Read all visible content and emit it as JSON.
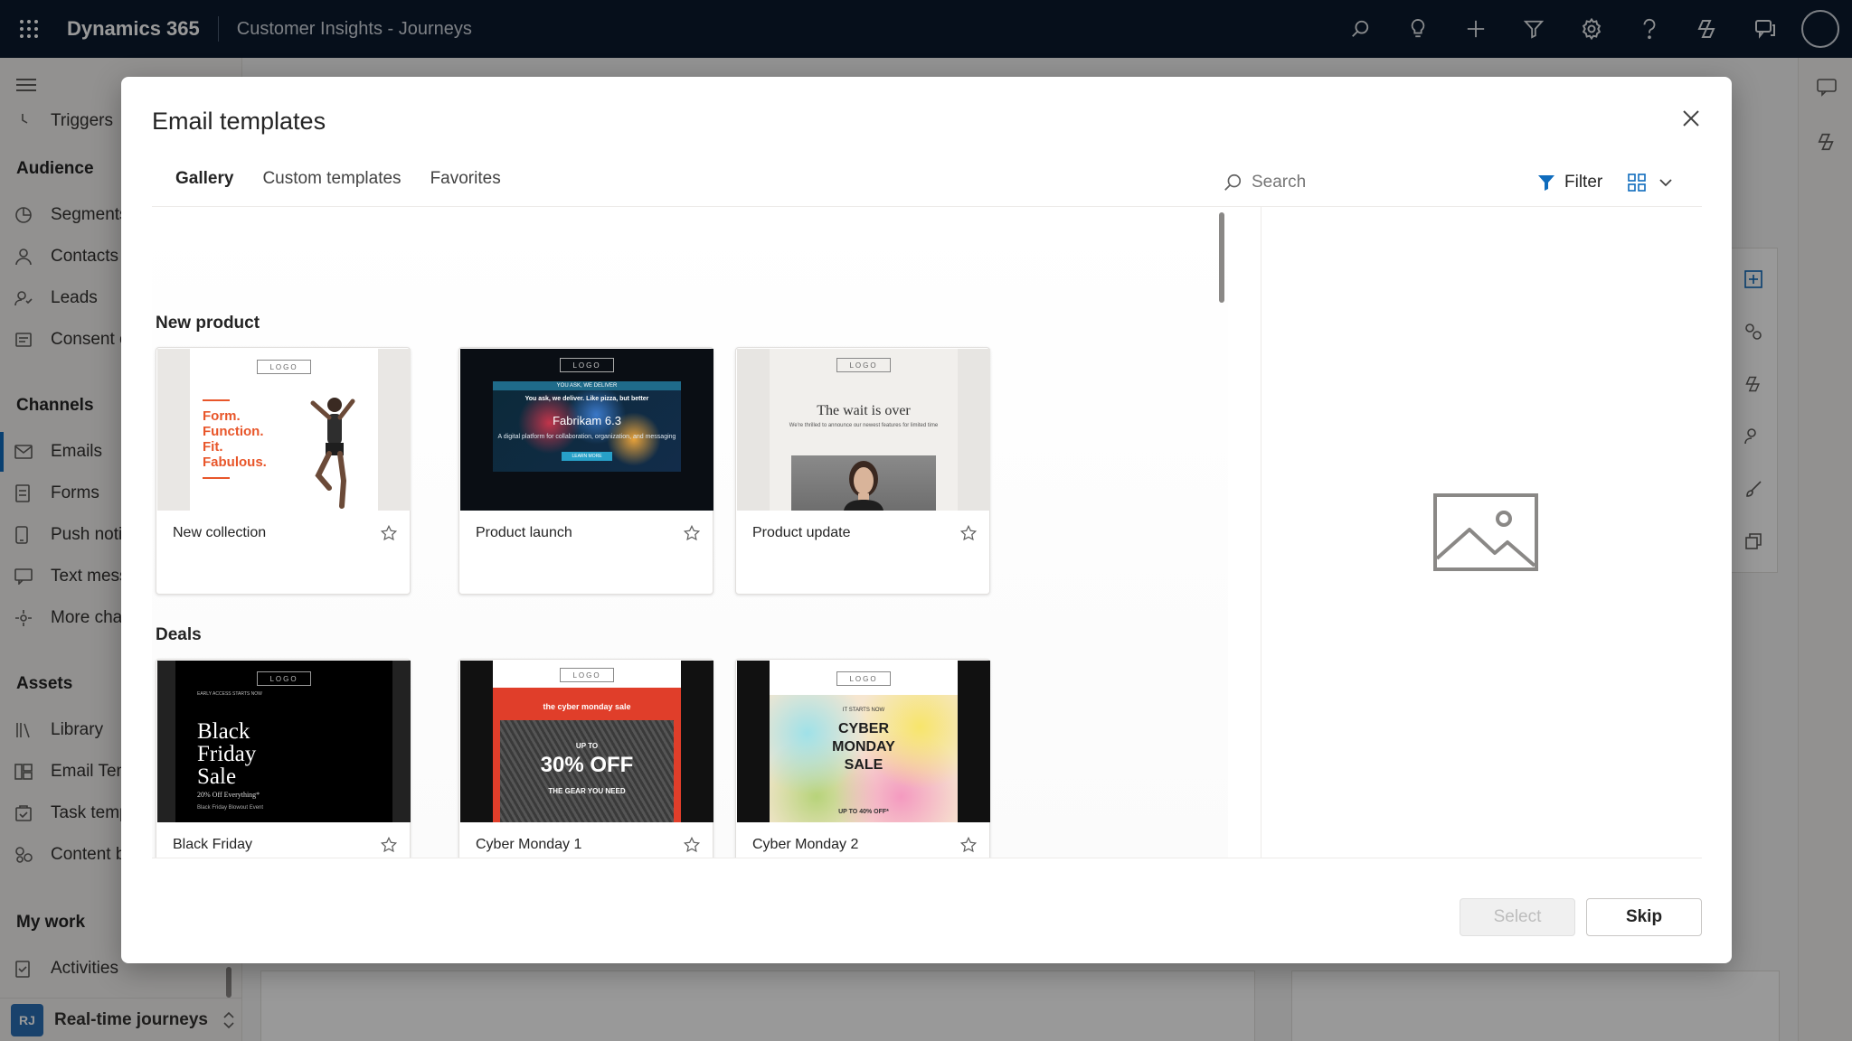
{
  "topbar": {
    "app_name": "Dynamics 365",
    "app_sub": "Customer Insights - Journeys",
    "icons": [
      "search-icon",
      "lightbulb-icon",
      "add-icon",
      "filter-icon",
      "settings-icon",
      "help-icon",
      "copilot-icon",
      "chat-icon",
      "profile-avatar"
    ]
  },
  "nav": {
    "partial_item": "Triggers",
    "groups": {
      "audience": "Audience",
      "channels": "Channels",
      "assets": "Assets",
      "mywork": "My work"
    },
    "items": {
      "segments": "Segments",
      "contacts": "Contacts",
      "leads": "Leads",
      "consent": "Consent center",
      "emails": "Emails",
      "forms": "Forms",
      "push": "Push notifications",
      "text": "Text messages",
      "more": "More channels",
      "library": "Library",
      "email_templates": "Email Templates",
      "task_templates": "Task templates",
      "content": "Content blocks",
      "activities": "Activities"
    },
    "area": {
      "badge": "RJ",
      "label": "Real-time journeys"
    }
  },
  "dialog": {
    "title": "Email templates",
    "tabs": [
      "Gallery",
      "Custom templates",
      "Favorites"
    ],
    "active_tab": "Gallery",
    "search_placeholder": "Search",
    "filter_label": "Filter",
    "sections": {
      "new_product": "New product",
      "deals": "Deals"
    },
    "cards": {
      "new_collection": "New collection",
      "product_launch": "Product launch",
      "product_update": "Product update",
      "black_friday": "Black Friday",
      "cyber_monday_1": "Cyber Monday 1",
      "cyber_monday_2": "Cyber Monday 2"
    },
    "thumb_text": {
      "logo": "LOGO",
      "form_lines": [
        "Form.",
        "Function.",
        "Fit.",
        "Fabulous."
      ],
      "launch_kicker": "YOU ASK, WE DELIVER",
      "launch_tagline": "You ask, we deliver. Like pizza, but better",
      "launch_product": "Fabrikam 6.3",
      "launch_desc": "A digital platform for collaboration, organization, and messaging",
      "launch_cta": "LEARN MORE",
      "update_headline": "The wait is over",
      "update_desc": "We're thrilled to announce our newest features for limited time",
      "bf_kicker": "EARLY ACCESS STARTS NOW",
      "bf_lines": [
        "Black",
        "Friday",
        "Sale"
      ],
      "bf_offer": "20% Off Everything*",
      "bf_event": "Black Friday Blowout Event",
      "cm1_banner": "the cyber monday sale",
      "cm1_upto": "UP TO",
      "cm1_offer": "30% OFF",
      "cm1_sub": "THE GEAR YOU NEED",
      "cm2_kicker": "IT STARTS NOW",
      "cm2_lines": [
        "CYBER",
        "MONDAY",
        "SALE"
      ],
      "cm2_offer": "UP TO 40% OFF*"
    },
    "preview_icon": "image-placeholder-icon",
    "select_label": "Select",
    "skip_label": "Skip"
  }
}
